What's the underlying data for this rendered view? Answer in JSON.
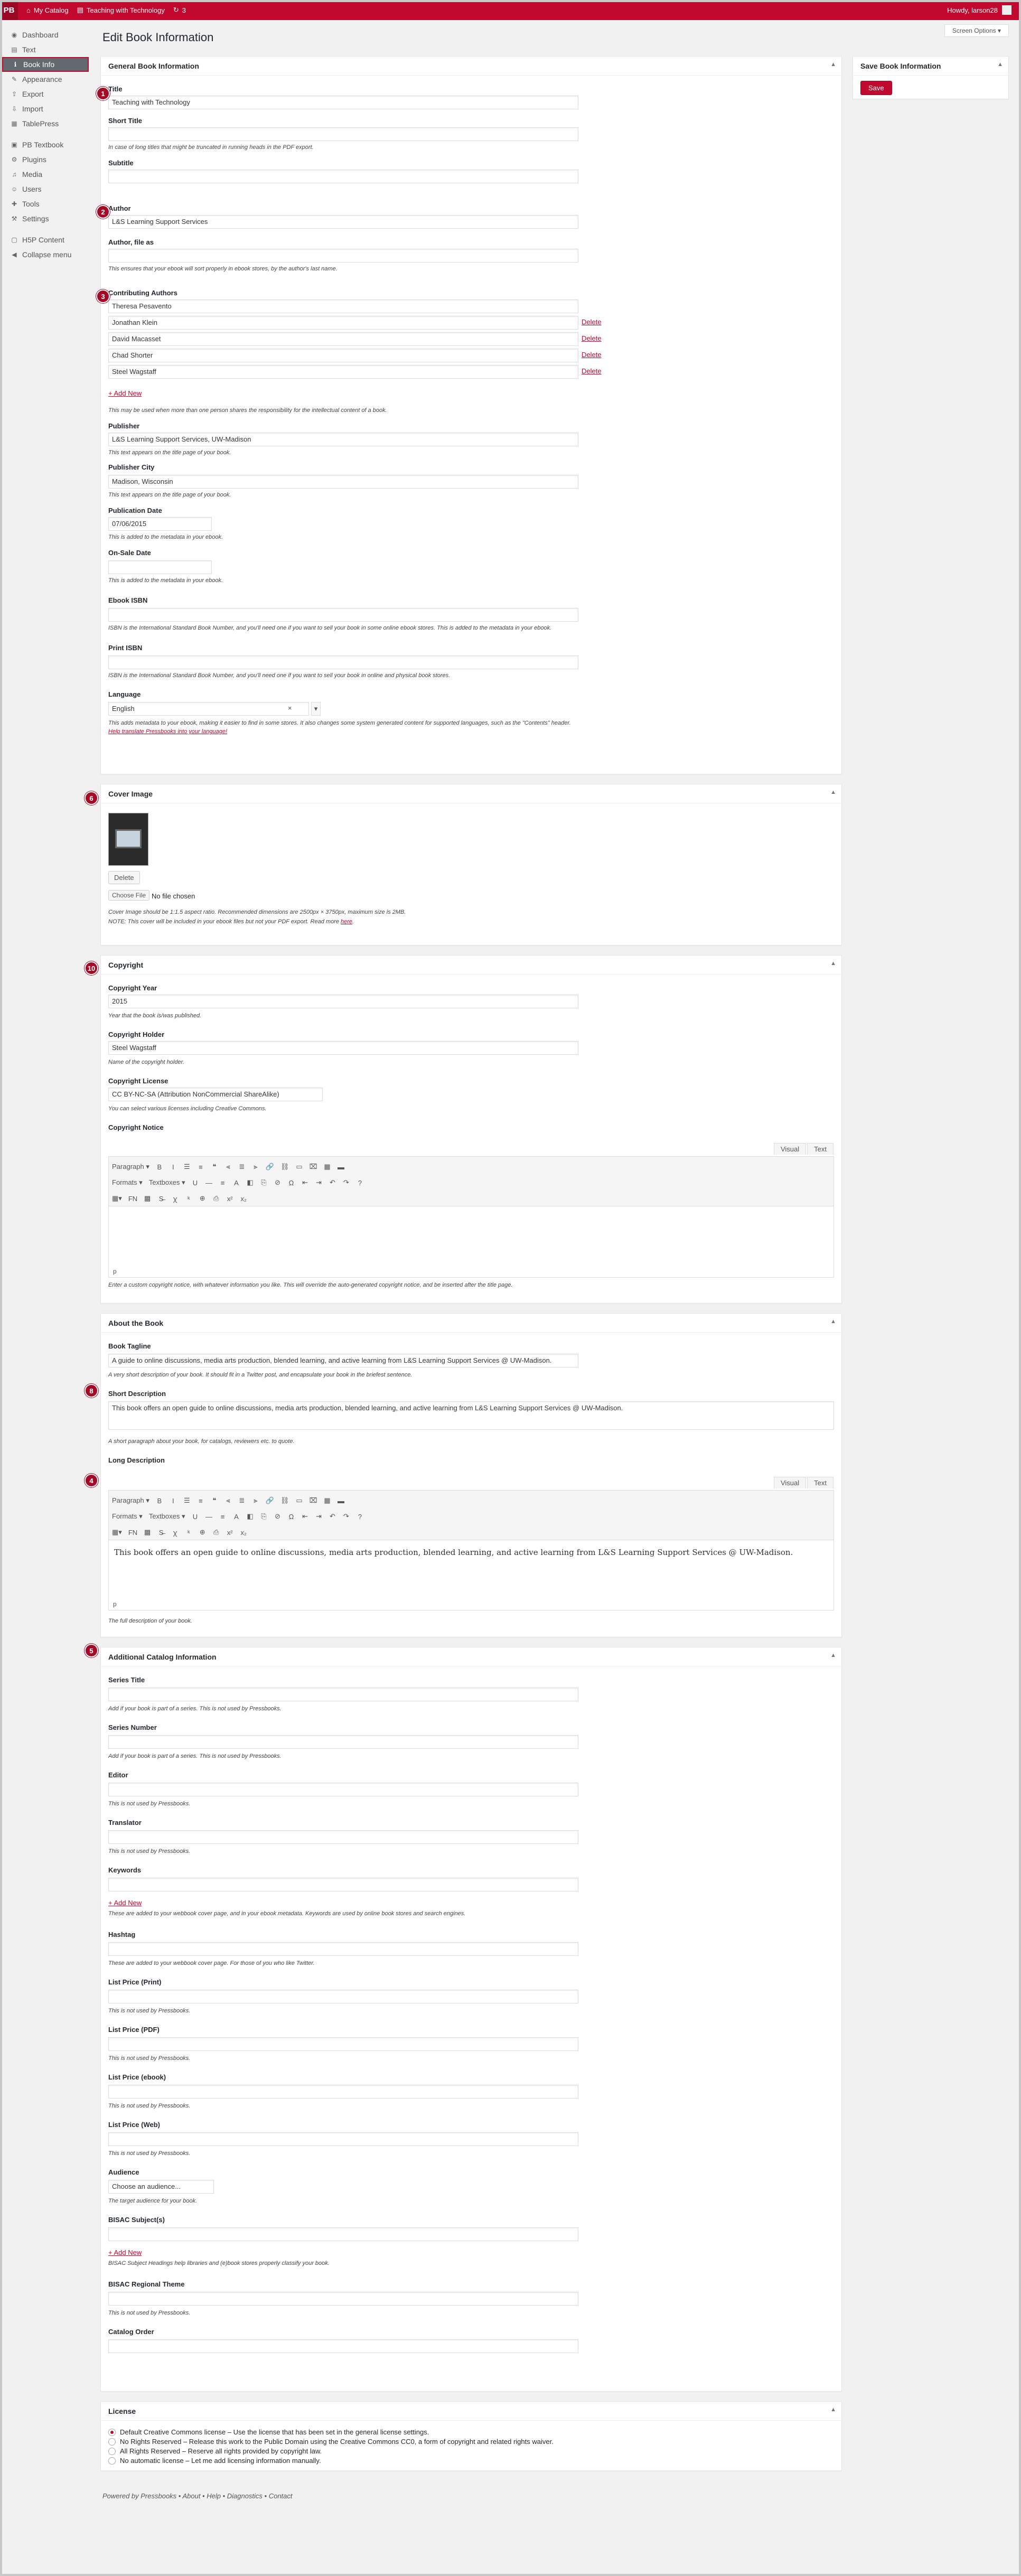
{
  "adminbar": {
    "logo": "PB",
    "catalog": "My Catalog",
    "book": "Teaching with Technology",
    "updates": "3",
    "howdy": "Howdy, larson28"
  },
  "sidebar": {
    "items": [
      {
        "label": "Dashboard",
        "icon": "dashboard-icon",
        "glyph": "◉"
      },
      {
        "label": "Text",
        "icon": "text-icon",
        "glyph": "▤"
      },
      {
        "label": "Book Info",
        "icon": "book-info-icon",
        "glyph": "ℹ"
      },
      {
        "label": "Appearance",
        "icon": "appearance-icon",
        "glyph": "✎"
      },
      {
        "label": "Export",
        "icon": "export-icon",
        "glyph": "⇪"
      },
      {
        "label": "Import",
        "icon": "import-icon",
        "glyph": "⇩"
      },
      {
        "label": "TablePress",
        "icon": "tablepress-icon",
        "glyph": "▦"
      },
      {
        "label": "PB Textbook",
        "icon": "pb-textbook-icon",
        "glyph": "▣"
      },
      {
        "label": "Plugins",
        "icon": "plugins-icon",
        "glyph": "⚙"
      },
      {
        "label": "Media",
        "icon": "media-icon",
        "glyph": "♫"
      },
      {
        "label": "Users",
        "icon": "users-icon",
        "glyph": "☺"
      },
      {
        "label": "Tools",
        "icon": "tools-icon",
        "glyph": "✚"
      },
      {
        "label": "Settings",
        "icon": "settings-icon",
        "glyph": "⚒"
      },
      {
        "label": "H5P Content",
        "icon": "h5p-icon",
        "glyph": "▢"
      },
      {
        "label": "Collapse menu",
        "icon": "collapse-icon",
        "glyph": "◀"
      }
    ]
  },
  "page": {
    "title": "Edit Book Information",
    "screen_options": "Screen Options ▾"
  },
  "save_box": {
    "title": "Save Book Information",
    "button": "Save"
  },
  "general": {
    "title": "General Book Information",
    "title_label": "Title",
    "title_value": "Teaching with Technology",
    "short_title_label": "Short Title",
    "short_title_desc": "In case of long titles that might be truncated in running heads in the PDF export.",
    "subtitle_label": "Subtitle",
    "author_label": "Author",
    "author_value": "L&S Learning Support Services",
    "author_file_as_label": "Author, file as",
    "author_file_as_desc": "This ensures that your ebook will sort properly in ebook stores, by the author's last name.",
    "contrib_label": "Contributing Authors",
    "contributors": [
      "Theresa Pesavento",
      "Jonathan Klein",
      "David Macasset",
      "Chad Shorter",
      "Steel Wagstaff"
    ],
    "delete": "Delete",
    "add_new": "+ Add New",
    "contrib_desc": "This may be used when more than one person shares the responsibility for the intellectual content of a book.",
    "publisher_label": "Publisher",
    "publisher_value": "L&S Learning Support Services, UW-Madison",
    "publisher_desc": "This text appears on the title page of your book.",
    "city_label": "Publisher City",
    "city_value": "Madison, Wisconsin",
    "city_desc": "This text appears on the title page of your book.",
    "pubdate_label": "Publication Date",
    "pubdate_value": "07/06/2015",
    "pubdate_desc": "This is added to the metadata in your ebook.",
    "onsale_label": "On-Sale Date",
    "onsale_desc": "This is added to the metadata in your ebook.",
    "ebook_isbn_label": "Ebook ISBN",
    "ebook_isbn_desc": "ISBN is the International Standard Book Number, and you'll need one if you want to sell your book in some online ebook stores. This is added to the metadata in your ebook.",
    "print_isbn_label": "Print ISBN",
    "print_isbn_desc": "ISBN is the International Standard Book Number, and you'll need one if you want to sell your book in online and physical book stores.",
    "language_label": "Language",
    "language_value": "English",
    "language_desc": "This adds metadata to your ebook, making it easier to find in some stores. It also changes some system generated content for supported languages, such as the \"Contents\" header.",
    "language_link": "Help translate Pressbooks into your language!"
  },
  "cover": {
    "title": "Cover Image",
    "delete": "Delete",
    "choose": "Choose File",
    "no_file": "No file chosen",
    "desc1": "Cover Image should be 1:1.5 aspect ratio. Recommended dimensions are 2500px × 3750px, maximum size is 2MB.",
    "desc2": "NOTE: This cover will be included in your ebook files but not your PDF export. Read more",
    "desc2_link": "here"
  },
  "copyright": {
    "title": "Copyright",
    "year_label": "Copyright Year",
    "year_value": "2015",
    "year_desc": "Year that the book is/was published.",
    "holder_label": "Copyright Holder",
    "holder_value": "Steel Wagstaff",
    "holder_desc": "Name of the copyright holder.",
    "license_label": "Copyright License",
    "license_value": "CC BY-NC-SA (Attribution NonCommercial ShareAlike)",
    "license_desc": "You can select various licenses including Creative Commons.",
    "notice_label": "Copyright Notice",
    "notice_desc": "Enter a custom copyright notice, with whatever information you like. This will override the auto-generated copyright notice, and be inserted after the title page.",
    "path": "p"
  },
  "editor": {
    "visual": "Visual",
    "text": "Text",
    "paragraph": "Paragraph ▾",
    "formats": "Formats ▾",
    "textboxes": "Textboxes ▾"
  },
  "about": {
    "title": "About the Book",
    "tagline_label": "Book Tagline",
    "tagline_value": "A guide to online discussions, media arts production, blended learning, and active learning from L&S Learning Support Services @ UW-Madison.",
    "tagline_desc": "A very short description of your book. It should fit in a Twitter post, and encapsulate your book in the briefest sentence.",
    "short_label": "Short Description",
    "short_value": "This book offers an open guide to online discussions, media arts production, blended learning, and active learning from L&S Learning Support Services @ UW-Madison.",
    "short_desc": "A short paragraph about your book, for catalogs, reviewers etc. to quote.",
    "long_label": "Long Description",
    "long_value": "This book offers an open guide to online discussions, media arts production, blended learning, and active learning from L&S Learning Support Services @ UW-Madison.",
    "long_path": "p",
    "long_desc": "The full description of your book."
  },
  "catalog": {
    "title": "Additional Catalog Information",
    "fields": [
      {
        "label": "Series Title",
        "desc": "Add if your book is part of a series. This is not used by Pressbooks."
      },
      {
        "label": "Series Number",
        "desc": "Add if your book is part of a series. This is not used by Pressbooks."
      },
      {
        "label": "Editor",
        "desc": "This is not used by Pressbooks."
      },
      {
        "label": "Translator",
        "desc": "This is not used by Pressbooks."
      }
    ],
    "keywords_label": "Keywords",
    "keywords_add": "+ Add New",
    "keywords_desc": "These are added to your webbook cover page, and in your ebook metadata. Keywords are used by online book stores and search engines.",
    "hashtag_label": "Hashtag",
    "hashtag_desc": "These are added to your webbook cover page. For those of you who like Twitter.",
    "prices": [
      {
        "label": "List Price (Print)",
        "desc": "This is not used by Pressbooks."
      },
      {
        "label": "List Price (PDF)",
        "desc": "This is not used by Pressbooks."
      },
      {
        "label": "List Price (ebook)",
        "desc": "This is not used by Pressbooks."
      },
      {
        "label": "List Price (Web)",
        "desc": "This is not used by Pressbooks."
      }
    ],
    "audience_label": "Audience",
    "audience_value": "Choose an audience...",
    "audience_desc": "The target audience for your book.",
    "bisac_label": "BISAC Subject(s)",
    "bisac_add": "+ Add New",
    "bisac_desc": "BISAC Subject Headings help libraries and (e)book stores properly classify your book.",
    "theme_label": "BISAC Regional Theme",
    "theme_desc": "This is not used by Pressbooks.",
    "order_label": "Catalog Order"
  },
  "license": {
    "title": "License",
    "options": [
      "Default Creative Commons license – Use the license that has been set in the general license settings.",
      "No Rights Reserved – Release this work to the Public Domain using the Creative Commons CC0, a form of copyright and related rights waiver.",
      "All Rights Reserved – Reserve all rights provided by copyright law.",
      "No automatic license – Let me add licensing information manually."
    ]
  },
  "footer": {
    "text": "Powered by Pressbooks • About • Help • Diagnostics • Contact"
  },
  "badges": [
    "1",
    "2",
    "3",
    "6",
    "10",
    "8",
    "4",
    "5",
    "9"
  ],
  "colors": {
    "accent": "#c1082f",
    "badge": "#a40a26"
  }
}
